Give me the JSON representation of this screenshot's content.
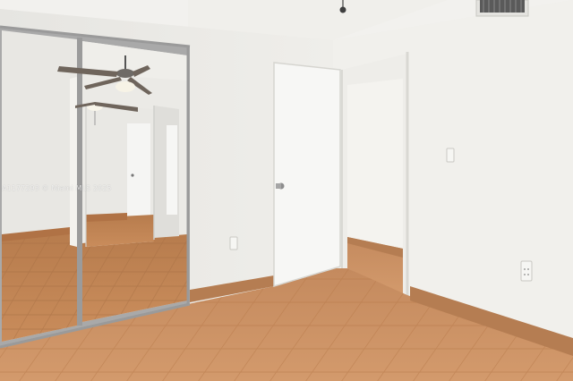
{
  "photo": {
    "watermark": "A1177293 © Miami MLS 2025"
  },
  "scene_objects": [
    "mirrored-closet-doors",
    "ceiling-fan-reflection",
    "open-interior-door",
    "doorway-to-hallway",
    "tile-floor",
    "baseboard",
    "electrical-outlet",
    "light-switch",
    "ceiling-vent",
    "smoke-detector"
  ],
  "colors": {
    "wall": "#ecebe7",
    "ceiling": "#f2f1ee",
    "floor": "#c98b5c",
    "baseboard": "#b57d52",
    "door": "#f7f7f5",
    "mirror_frame": "#a9a9a9"
  }
}
